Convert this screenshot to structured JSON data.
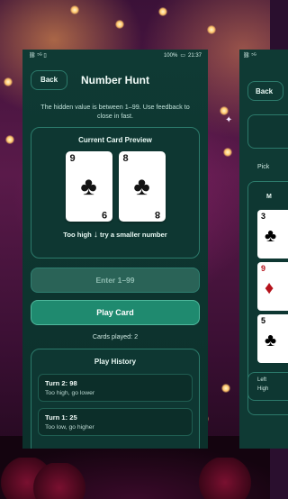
{
  "status_bar": {
    "left_icons": "⛓ ⁵ᴳ ▯",
    "battery": "100%",
    "time": "21:37"
  },
  "header": {
    "back_label": "Back",
    "title": "Number Hunt"
  },
  "hint_text": "The hidden value is between 1–99. Use feedback to close in fast.",
  "preview": {
    "title": "Current Card Preview",
    "cards": [
      {
        "rank": "9",
        "suit": "♣"
      },
      {
        "rank": "8",
        "suit": "♣"
      }
    ],
    "feedback_prefix": "Too high",
    "feedback_arrow": "↓",
    "feedback_suffix": "try a smaller number"
  },
  "input": {
    "placeholder": "Enter 1–99"
  },
  "play_button_label": "Play Card",
  "cards_played_text": "Cards played: 2",
  "history": {
    "title": "Play History",
    "items": [
      {
        "turn": "Turn 2: 98",
        "note": "Too high, go lower"
      },
      {
        "turn": "Turn 1: 25",
        "note": "Too low, go higher"
      }
    ]
  },
  "second_screen": {
    "status_icons": "⛓ ⁵ᴳ",
    "back_label": "Back",
    "pick_label": "Pick",
    "m_label": "M",
    "cards": [
      {
        "rank": "3",
        "suit": "♣"
      },
      {
        "rank": "9",
        "suit": "♦"
      },
      {
        "rank": "5",
        "suit": "♣"
      }
    ],
    "footer_line1": "Left",
    "footer_line2": "High"
  }
}
